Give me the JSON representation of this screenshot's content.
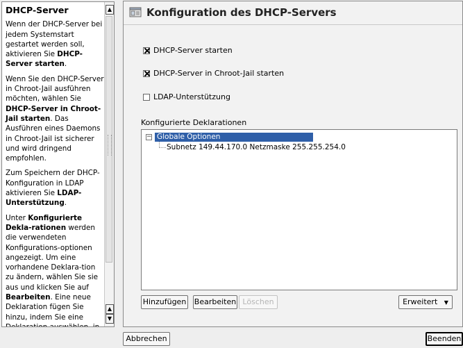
{
  "help": {
    "title": "DHCP-Server",
    "paragraphs": [
      "Wenn der DHCP-Server bei jedem Systemstart gestartet werden soll, aktivieren Sie DHCP-Server starten.",
      "Wenn Sie den DHCP-Server in Chroot-Jail ausführen möchten, wählen Sie DHCP-Server in Chroot-Jail starten. Das Ausführen eines Daemons in Chroot-Jail ist sicherer und wird dringend empfohlen.",
      "Zum Speichern der DHCP-Konfiguration in LDAP aktivieren Sie LDAP-Unterstützung.",
      "Unter Konfigurierte Dekla-rationen werden die verwendeten Konfigurations-optionen angezeigt. Um eine vorhandene Deklara-tion zu ändern, wählen Sie sie aus und klicken Sie auf Bearbeiten. Eine neue Deklaration fügen Sie hinzu, indem Sie eine Deklaration auswählen, in der die neue Deklaration"
    ]
  },
  "main": {
    "title": "Konfiguration des DHCP-Servers",
    "title_icon": "server-config-icon",
    "checkboxes": [
      {
        "label": "DHCP-Server starten",
        "checked": true
      },
      {
        "label": "DHCP-Server in Chroot-Jail starten",
        "checked": true
      },
      {
        "label": "LDAP-Unterstützung",
        "checked": false
      }
    ],
    "declarations_label": "Konfigurierte Deklarationen",
    "tree": {
      "root": "Globale Optionen",
      "child": "Subnetz 149.44.170.0 Netzmaske 255.255.254.0"
    },
    "buttons": {
      "add": "Hinzufügen",
      "edit": "Bearbeiten",
      "delete": "Löschen",
      "advanced": "Erweitert"
    }
  },
  "footer": {
    "cancel": "Abbrechen",
    "finish": "Beenden"
  },
  "colors": {
    "selection": "#2f5fa8",
    "background": "#eeeeee"
  }
}
